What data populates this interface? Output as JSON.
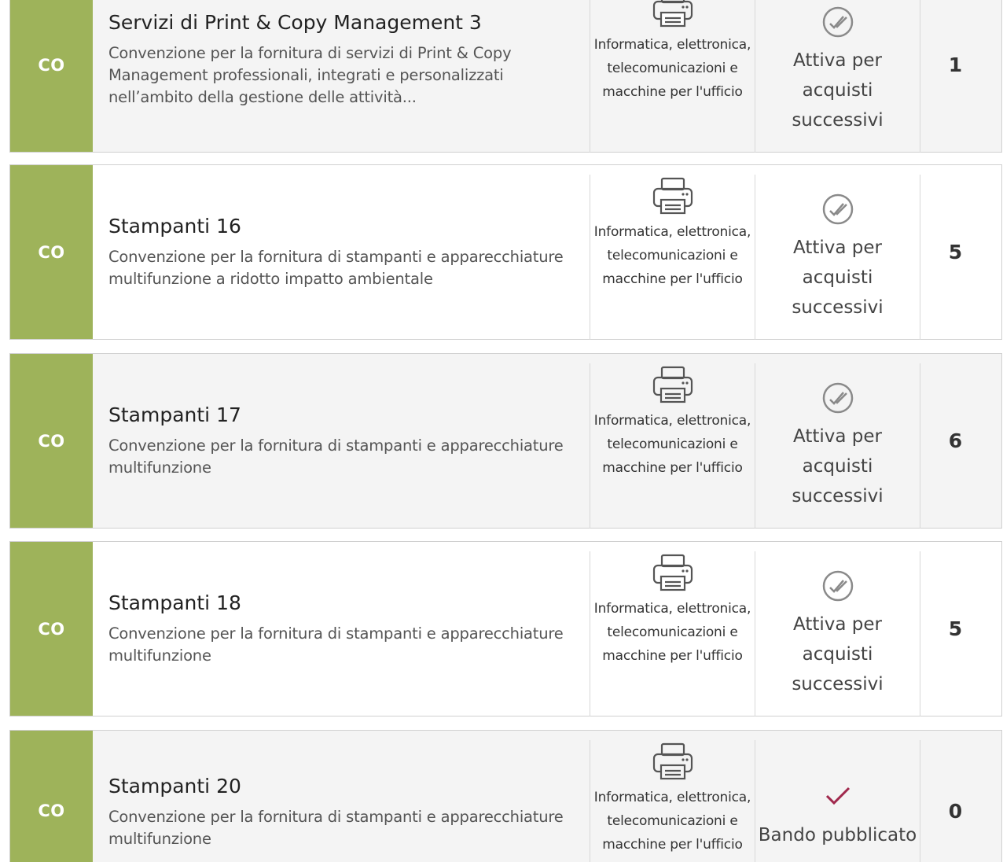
{
  "rows": [
    {
      "type": "CO",
      "title": "Servizi di Print & Copy Management 3",
      "description": "Convenzione per la fornitura di servizi di Print & Copy Management professionali, integrati e personalizzati nell’ambito della gestione delle attività...",
      "category": "Informatica, elettronica, telecomunicazioni e macchine per l'ufficio",
      "category_icon": "printer-icon",
      "status": "Attiva per acquisti successivi",
      "status_icon": "double-check-circle-icon",
      "count": "1"
    },
    {
      "type": "CO",
      "title": "Stampanti 16",
      "description": "Convenzione per la fornitura di stampanti e apparecchiature multifunzione a ridotto impatto ambientale",
      "category": "Informatica, elettronica, telecomunicazioni e macchine per l'ufficio",
      "category_icon": "printer-icon",
      "status": "Attiva per acquisti successivi",
      "status_icon": "double-check-circle-icon",
      "count": "5"
    },
    {
      "type": "CO",
      "title": "Stampanti 17",
      "description": "Convenzione per la fornitura di stampanti e apparecchiature multifunzione",
      "category": "Informatica, elettronica, telecomunicazioni e macchine per l'ufficio",
      "category_icon": "printer-icon",
      "status": "Attiva per acquisti successivi",
      "status_icon": "double-check-circle-icon",
      "count": "6"
    },
    {
      "type": "CO",
      "title": "Stampanti 18",
      "description": "Convenzione per la fornitura di stampanti e apparecchiature multifunzione",
      "category": "Informatica, elettronica, telecomunicazioni e macchine per l'ufficio",
      "category_icon": "printer-icon",
      "status": "Attiva per acquisti successivi",
      "status_icon": "double-check-circle-icon",
      "count": "5"
    },
    {
      "type": "CO",
      "title": "Stampanti 20",
      "description": "Convenzione per la fornitura di stampanti e apparecchiature multifunzione",
      "category": "Informatica, elettronica, telecomunicazioni e macchine per l'ufficio",
      "category_icon": "printer-icon",
      "status": "Bando pubblicato",
      "status_icon": "check-mark-icon",
      "count": "0"
    }
  ],
  "colors": {
    "type_badge": "#9eb35a",
    "published_check": "#a0284c",
    "active_icon": "#8a8a8a"
  }
}
